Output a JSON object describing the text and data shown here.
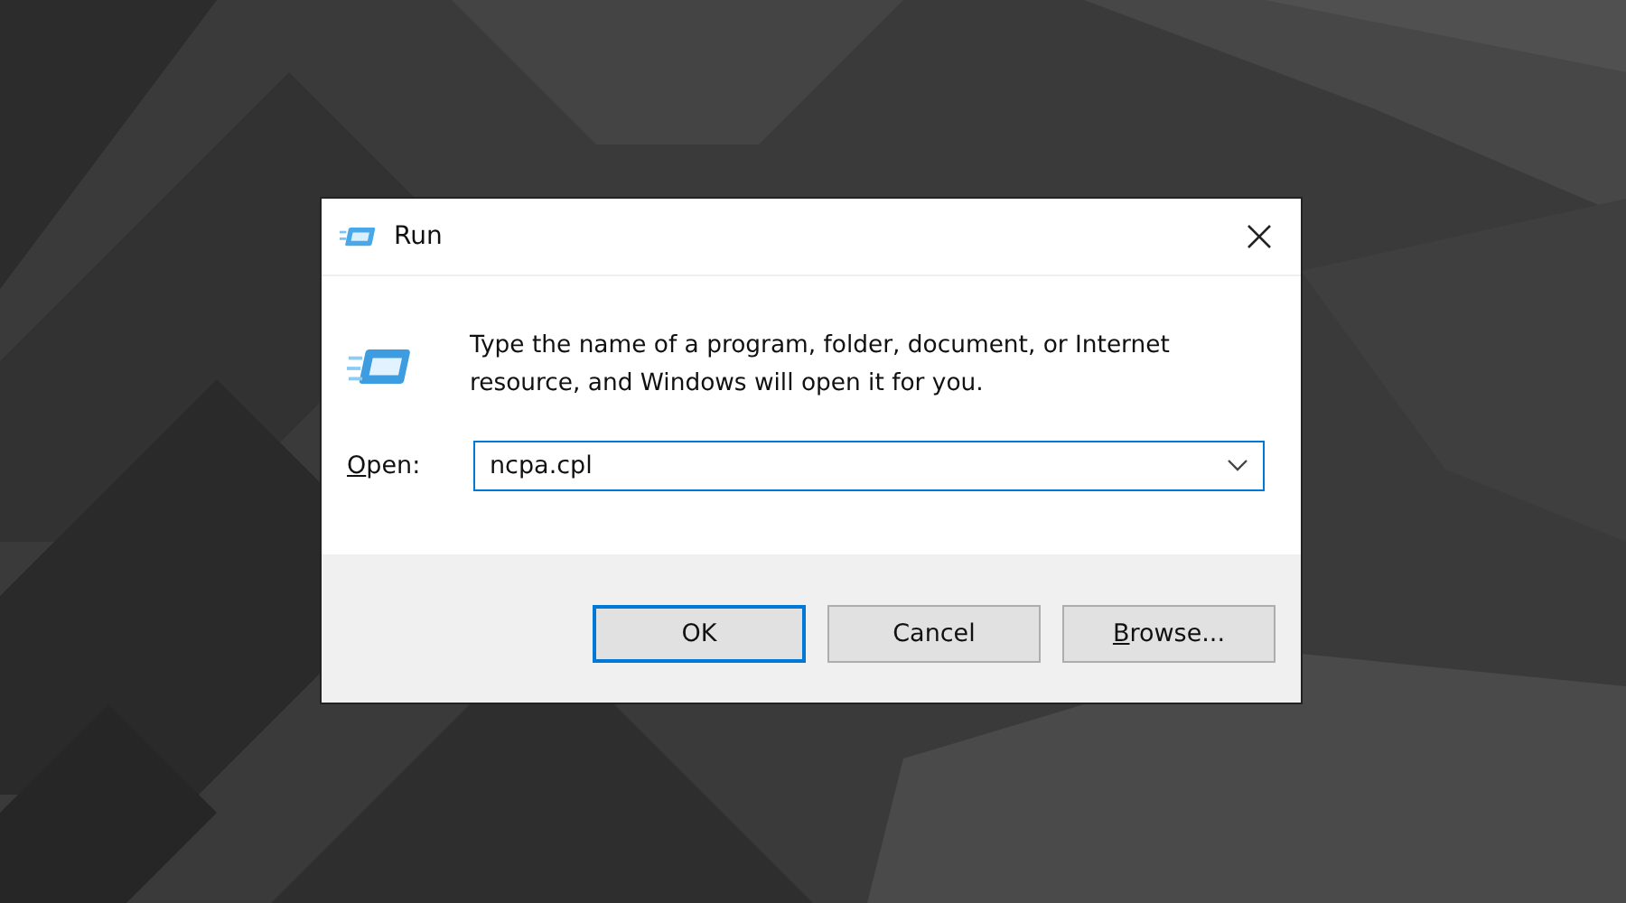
{
  "window": {
    "title": "Run"
  },
  "message": "Type the name of a program, folder, document, or Internet resource, and Windows will open it for you.",
  "open_field": {
    "label": [
      {
        "text": "O",
        "underlined": true
      },
      {
        "text": "pen:",
        "underlined": false
      }
    ],
    "value": "ncpa.cpl"
  },
  "buttons": [
    {
      "label": [
        {
          "text": "OK",
          "underlined": false
        }
      ],
      "default": true
    },
    {
      "label": [
        {
          "text": "Cancel",
          "underlined": false
        }
      ],
      "default": false
    },
    {
      "label": [
        {
          "text": "B",
          "underlined": true
        },
        {
          "text": "rowse...",
          "underlined": false
        }
      ],
      "default": false
    }
  ]
}
